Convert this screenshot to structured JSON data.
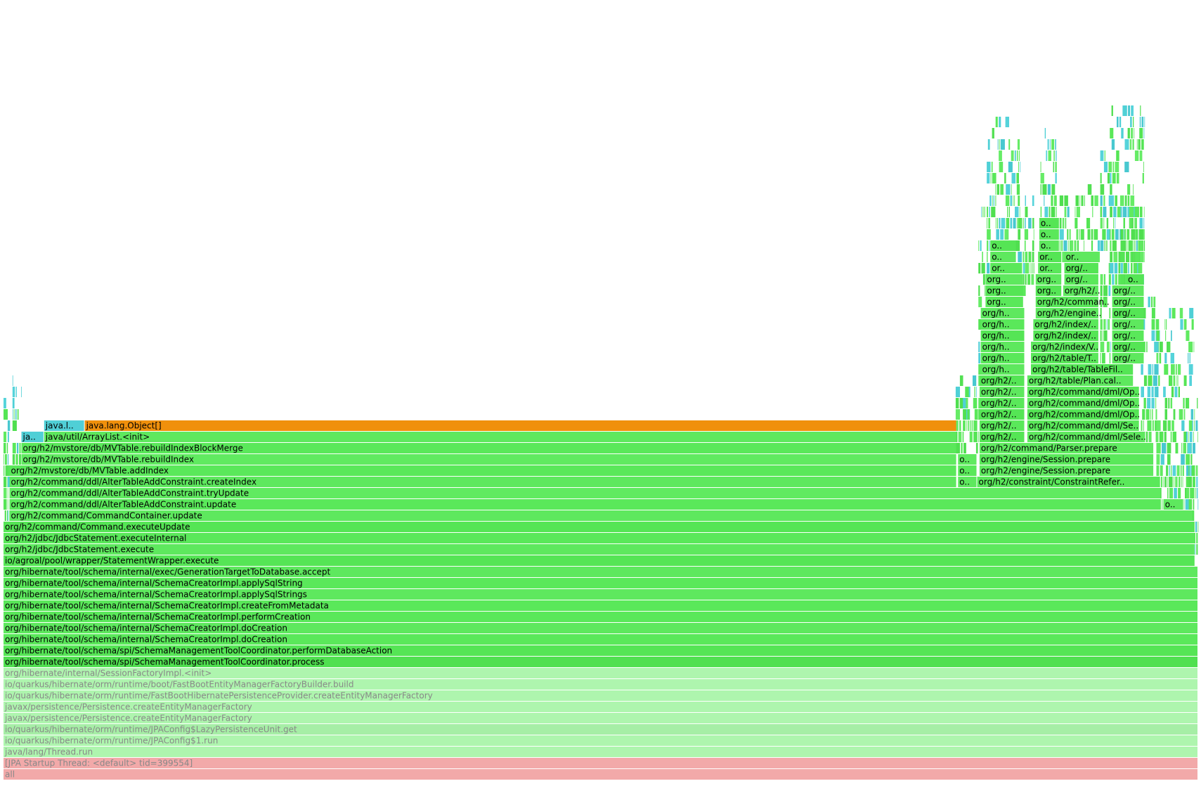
{
  "chart_data": {
    "type": "flame",
    "frames": [
      {
        "label": "all",
        "depth": 0,
        "start": 0.0,
        "end": 1.0,
        "color": "#f2a9a9",
        "text_color": "#888888"
      },
      {
        "label": "[JPA Startup Thread: <default> tid=399554]",
        "depth": 1,
        "start": 0.0,
        "end": 1.0,
        "color": "#f2a9a9",
        "text_color": "#888888"
      },
      {
        "label": "java/lang/Thread.run",
        "depth": 2,
        "start": 0.0,
        "end": 1.0,
        "color": "#aef5ae",
        "text_color": "#888888"
      },
      {
        "label": "io/quarkus/hibernate/orm/runtime/JPAConfig$1.run",
        "depth": 3,
        "start": 0.0,
        "end": 1.0,
        "color": "#aef5ae",
        "text_color": "#888888"
      },
      {
        "label": "io/quarkus/hibernate/orm/runtime/JPAConfig$LazyPersistenceUnit.get",
        "depth": 4,
        "start": 0.0,
        "end": 1.0,
        "color": "#a6eea6",
        "text_color": "#888888"
      },
      {
        "label": "javax/persistence/Persistence.createEntityManagerFactory",
        "depth": 5,
        "start": 0.0,
        "end": 1.0,
        "color": "#aef5ae",
        "text_color": "#888888"
      },
      {
        "label": "javax/persistence/Persistence.createEntityManagerFactory",
        "depth": 6,
        "start": 0.0,
        "end": 1.0,
        "color": "#aef5ae",
        "text_color": "#888888"
      },
      {
        "label": "io/quarkus/hibernate/orm/runtime/FastBootHibernatePersistenceProvider.createEntityManagerFactory",
        "depth": 7,
        "start": 0.0,
        "end": 1.0,
        "color": "#aef5ae",
        "text_color": "#888888"
      },
      {
        "label": "io/quarkus/hibernate/orm/runtime/boot/FastBootEntityManagerFactoryBuilder.build",
        "depth": 8,
        "start": 0.0,
        "end": 1.0,
        "color": "#aef5ae",
        "text_color": "#888888"
      },
      {
        "label": "org/hibernate/internal/SessionFactoryImpl.<init>",
        "depth": 9,
        "start": 0.0,
        "end": 1.0,
        "color": "#aef5ae",
        "text_color": "#888888"
      },
      {
        "label": "org/hibernate/tool/schema/spi/SchemaManagementToolCoordinator.process",
        "depth": 10,
        "start": 0.0,
        "end": 1.0,
        "color": "#50e050"
      },
      {
        "label": "org/hibernate/tool/schema/spi/SchemaManagementToolCoordinator.performDatabaseAction",
        "depth": 11,
        "start": 0.0,
        "end": 1.0,
        "color": "#55e555"
      },
      {
        "label": "org/hibernate/tool/schema/internal/SchemaCreatorImpl.doCreation",
        "depth": 12,
        "start": 0.0,
        "end": 1.0,
        "color": "#5ae85a"
      },
      {
        "label": "org/hibernate/tool/schema/internal/SchemaCreatorImpl.doCreation",
        "depth": 13,
        "start": 0.0,
        "end": 1.0,
        "color": "#5ee85e"
      },
      {
        "label": "org/hibernate/tool/schema/internal/SchemaCreatorImpl.performCreation",
        "depth": 14,
        "start": 0.0,
        "end": 1.0,
        "color": "#5ae85a"
      },
      {
        "label": "org/hibernate/tool/schema/internal/SchemaCreatorImpl.createFromMetadata",
        "depth": 15,
        "start": 0.0,
        "end": 1.0,
        "color": "#5ae85a"
      },
      {
        "label": "org/hibernate/tool/schema/internal/SchemaCreatorImpl.applySqlStrings",
        "depth": 16,
        "start": 0.0,
        "end": 1.0,
        "color": "#5ee85e"
      },
      {
        "label": "org/hibernate/tool/schema/internal/SchemaCreatorImpl.applySqlString",
        "depth": 17,
        "start": 0.0,
        "end": 1.0,
        "color": "#5ae85a"
      },
      {
        "label": "org/hibernate/tool/schema/internal/exec/GenerationTargetToDatabase.accept",
        "depth": 18,
        "start": 0.0,
        "end": 1.0,
        "color": "#5ee85e"
      },
      {
        "label": "io/agroal/pool/wrapper/StatementWrapper.execute",
        "depth": 19,
        "start": 0.0,
        "end": 0.9975,
        "color": "#55e555"
      },
      {
        "label": "org/h2/jdbc/JdbcStatement.execute",
        "depth": 20,
        "start": 0.0,
        "end": 0.9975,
        "color": "#5ee85e"
      },
      {
        "label": "org/h2/jdbc/JdbcStatement.executeInternal",
        "depth": 21,
        "start": 0.0,
        "end": 0.9975,
        "color": "#5ae85a"
      },
      {
        "label": "org/h2/command/Command.executeUpdate",
        "depth": 22,
        "start": 0.0,
        "end": 0.9975,
        "color": "#55e555"
      },
      {
        "label": "org/h2/command/CommandContainer.update",
        "depth": 23,
        "start": 0.005,
        "end": 0.996,
        "color": "#5ee85e"
      },
      {
        "label": "org/h2/command/ddl/AlterTableAddConstraint.update",
        "depth": 24,
        "start": 0.005,
        "end": 0.969,
        "color": "#5ae85a"
      },
      {
        "label": "org/h2/command/ddl/AlterTableAddConstraint.tryUpdate",
        "depth": 25,
        "start": 0.005,
        "end": 0.969,
        "color": "#60ea60"
      },
      {
        "label": "org/h2/command/ddl/AlterTableAddConstraint.createIndex",
        "depth": 26,
        "start": 0.005,
        "end": 0.798,
        "color": "#5ee85e"
      },
      {
        "label": "org/h2/mvstore/db/MVTable.addIndex",
        "depth": 27,
        "start": 0.005,
        "end": 0.798,
        "color": "#5ae85a"
      },
      {
        "label": "org/h2/mvstore/db/MVTable.rebuildIndex",
        "depth": 28,
        "start": 0.015,
        "end": 0.798,
        "color": "#60ea60"
      },
      {
        "label": "org/h2/mvstore/db/MVTable.rebuildIndexBlockMerge",
        "depth": 29,
        "start": 0.015,
        "end": 0.798,
        "color": "#5ae85a"
      },
      {
        "label": "java/util/ArrayList.<init>",
        "depth": 30,
        "start": 0.034,
        "end": 0.798,
        "color": "#5ee85e"
      },
      {
        "label": "ja..",
        "depth": 30,
        "start": 0.015,
        "end": 0.034,
        "color": "#50cfd6"
      },
      {
        "label": "java.lang.Object[]",
        "depth": 31,
        "start": 0.068,
        "end": 0.798,
        "color": "#f0900c"
      },
      {
        "label": "java.l..",
        "depth": 31,
        "start": 0.034,
        "end": 0.068,
        "color": "#50cfd6"
      },
      {
        "label": "o..",
        "depth": 26,
        "start": 0.799,
        "end": 0.815,
        "color": "#5ee85e"
      },
      {
        "label": "o..",
        "depth": 27,
        "start": 0.799,
        "end": 0.815,
        "color": "#5ae85a"
      },
      {
        "label": "o..",
        "depth": 28,
        "start": 0.799,
        "end": 0.815,
        "color": "#60ea60"
      },
      {
        "label": "org/h2/constraint/ConstraintRefer..",
        "depth": 26,
        "start": 0.815,
        "end": 0.968,
        "color": "#5ae85a"
      },
      {
        "label": "org/h2/engine/Session.prepare",
        "depth": 27,
        "start": 0.817,
        "end": 0.963,
        "color": "#60ea60"
      },
      {
        "label": "org/h2/engine/Session.prepare",
        "depth": 28,
        "start": 0.817,
        "end": 0.963,
        "color": "#5ae85a"
      },
      {
        "label": "org/h2/command/Parser.prepare",
        "depth": 29,
        "start": 0.817,
        "end": 0.963,
        "color": "#60ea60"
      },
      {
        "label": "org/h2/..",
        "depth": 30,
        "start": 0.817,
        "end": 0.855,
        "color": "#55e555"
      },
      {
        "label": "org/h2/..",
        "depth": 31,
        "start": 0.817,
        "end": 0.855,
        "color": "#5ae85a"
      },
      {
        "label": "org/h2/..",
        "depth": 32,
        "start": 0.817,
        "end": 0.855,
        "color": "#55e555"
      },
      {
        "label": "org/h2/..",
        "depth": 33,
        "start": 0.817,
        "end": 0.855,
        "color": "#5ae85a"
      },
      {
        "label": "org/h2/..",
        "depth": 34,
        "start": 0.817,
        "end": 0.855,
        "color": "#5ee85e"
      },
      {
        "label": "org/h2/..",
        "depth": 35,
        "start": 0.817,
        "end": 0.855,
        "color": "#55e555"
      },
      {
        "label": "org/h..",
        "depth": 36,
        "start": 0.818,
        "end": 0.855,
        "color": "#5ee85e"
      },
      {
        "label": "org/h..",
        "depth": 37,
        "start": 0.818,
        "end": 0.855,
        "color": "#5ae85a"
      },
      {
        "label": "org/h..",
        "depth": 38,
        "start": 0.818,
        "end": 0.855,
        "color": "#5ee85e"
      },
      {
        "label": "org/h..",
        "depth": 39,
        "start": 0.818,
        "end": 0.855,
        "color": "#55e555"
      },
      {
        "label": "org/h..",
        "depth": 40,
        "start": 0.818,
        "end": 0.855,
        "color": "#5ae85a"
      },
      {
        "label": "org/h..",
        "depth": 41,
        "start": 0.818,
        "end": 0.855,
        "color": "#5ee85e"
      },
      {
        "label": "org..",
        "depth": 42,
        "start": 0.822,
        "end": 0.854,
        "color": "#5ae85a"
      },
      {
        "label": "org..",
        "depth": 43,
        "start": 0.822,
        "end": 0.854,
        "color": "#55e555"
      },
      {
        "label": "org..",
        "depth": 44,
        "start": 0.822,
        "end": 0.854,
        "color": "#5ee85e"
      },
      {
        "label": "or..",
        "depth": 45,
        "start": 0.826,
        "end": 0.852,
        "color": "#5ae85a"
      },
      {
        "label": "o..",
        "depth": 46,
        "start": 0.826,
        "end": 0.848,
        "color": "#5ee85e"
      },
      {
        "label": "o..",
        "depth": 47,
        "start": 0.826,
        "end": 0.848,
        "color": "#55e555"
      },
      {
        "label": "org/h2/command/dml/Sele..",
        "depth": 30,
        "start": 0.857,
        "end": 0.956,
        "color": "#5ee85e"
      },
      {
        "label": "org/h2/command/dml/Se..",
        "depth": 31,
        "start": 0.857,
        "end": 0.951,
        "color": "#5ae85a"
      },
      {
        "label": "org/h2/command/dml/Op..",
        "depth": 32,
        "start": 0.857,
        "end": 0.951,
        "color": "#55e555"
      },
      {
        "label": "org/h2/command/dml/Op..",
        "depth": 33,
        "start": 0.857,
        "end": 0.951,
        "color": "#5ee85e"
      },
      {
        "label": "org/h2/command/dml/Op..",
        "depth": 34,
        "start": 0.857,
        "end": 0.951,
        "color": "#5ae85a"
      },
      {
        "label": "org/h2/table/Plan.cal..",
        "depth": 35,
        "start": 0.857,
        "end": 0.946,
        "color": "#5ee85e"
      },
      {
        "label": "org/h2/table/TableFil..",
        "depth": 36,
        "start": 0.86,
        "end": 0.946,
        "color": "#55e555"
      },
      {
        "label": "org/h2/table/T..",
        "depth": 37,
        "start": 0.86,
        "end": 0.917,
        "color": "#5ae85a"
      },
      {
        "label": "org/h2/index/V..",
        "depth": 38,
        "start": 0.86,
        "end": 0.917,
        "color": "#5ee85e"
      },
      {
        "label": "org/h2/index/..",
        "depth": 39,
        "start": 0.862,
        "end": 0.917,
        "color": "#55e555"
      },
      {
        "label": "org/h2/index/..",
        "depth": 40,
        "start": 0.862,
        "end": 0.917,
        "color": "#5ae85a"
      },
      {
        "label": "org/h2/engine..",
        "depth": 41,
        "start": 0.864,
        "end": 0.917,
        "color": "#5ee85e"
      },
      {
        "label": "org/h2/comman..",
        "depth": 42,
        "start": 0.864,
        "end": 0.917,
        "color": "#5ae85a"
      },
      {
        "label": "org..",
        "depth": 43,
        "start": 0.864,
        "end": 0.886,
        "color": "#55e555"
      },
      {
        "label": "org..",
        "depth": 44,
        "start": 0.864,
        "end": 0.886,
        "color": "#5ee85e"
      },
      {
        "label": "or..",
        "depth": 45,
        "start": 0.866,
        "end": 0.886,
        "color": "#5ae85a"
      },
      {
        "label": "or..",
        "depth": 46,
        "start": 0.866,
        "end": 0.886,
        "color": "#55e555"
      },
      {
        "label": "o..",
        "depth": 47,
        "start": 0.867,
        "end": 0.884,
        "color": "#5ee85e"
      },
      {
        "label": "o..",
        "depth": 48,
        "start": 0.867,
        "end": 0.884,
        "color": "#5ae85a"
      },
      {
        "label": "o..",
        "depth": 49,
        "start": 0.867,
        "end": 0.884,
        "color": "#55e555"
      },
      {
        "label": "org/h2/..",
        "depth": 43,
        "start": 0.887,
        "end": 0.917,
        "color": "#5ee85e"
      },
      {
        "label": "org/..",
        "depth": 44,
        "start": 0.888,
        "end": 0.917,
        "color": "#5ae85a"
      },
      {
        "label": "org/..",
        "depth": 45,
        "start": 0.888,
        "end": 0.917,
        "color": "#55e555"
      },
      {
        "label": "or..",
        "depth": 46,
        "start": 0.888,
        "end": 0.917,
        "color": "#5ee85e"
      },
      {
        "label": "org/..",
        "depth": 37,
        "start": 0.928,
        "end": 0.955,
        "color": "#5ee85e"
      },
      {
        "label": "org/..",
        "depth": 38,
        "start": 0.928,
        "end": 0.955,
        "color": "#55e555"
      },
      {
        "label": "org/..",
        "depth": 39,
        "start": 0.928,
        "end": 0.955,
        "color": "#5ae85a"
      },
      {
        "label": "org/..",
        "depth": 40,
        "start": 0.928,
        "end": 0.955,
        "color": "#5ee85e"
      },
      {
        "label": "org/..",
        "depth": 41,
        "start": 0.928,
        "end": 0.955,
        "color": "#55e555"
      },
      {
        "label": "org/..",
        "depth": 42,
        "start": 0.928,
        "end": 0.955,
        "color": "#5ae85a"
      },
      {
        "label": "org/..",
        "depth": 43,
        "start": 0.928,
        "end": 0.955,
        "color": "#5ee85e"
      },
      {
        "label": "o..",
        "depth": 44,
        "start": 0.94,
        "end": 0.955,
        "color": "#55e555"
      },
      {
        "label": "o..",
        "depth": 24,
        "start": 0.971,
        "end": 0.988,
        "color": "#5ee85e"
      }
    ]
  }
}
